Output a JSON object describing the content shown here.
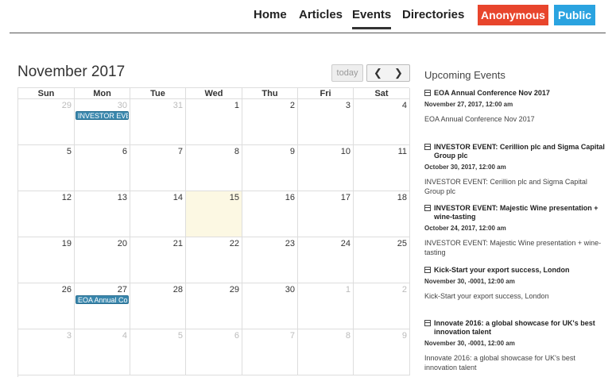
{
  "nav": {
    "links": [
      "Home",
      "Articles",
      "Events",
      "Directories"
    ],
    "anonymous": "Anonymous",
    "public": "Public"
  },
  "calendar": {
    "title": "November 2017",
    "today_label": "today",
    "prev_glyph": "❮",
    "next_glyph": "❯",
    "weekdays": [
      "Sun",
      "Mon",
      "Tue",
      "Wed",
      "Thu",
      "Fri",
      "Sat"
    ],
    "weeks": [
      [
        "29",
        "30",
        "31",
        "1",
        "2",
        "3",
        "4"
      ],
      [
        "5",
        "6",
        "7",
        "8",
        "9",
        "10",
        "11"
      ],
      [
        "12",
        "13",
        "14",
        "15",
        "16",
        "17",
        "18"
      ],
      [
        "19",
        "20",
        "21",
        "22",
        "23",
        "24",
        "25"
      ],
      [
        "26",
        "27",
        "28",
        "29",
        "30",
        "1",
        "2"
      ],
      [
        "3",
        "4",
        "5",
        "6",
        "7",
        "8",
        "9"
      ]
    ],
    "events": [
      "INVESTOR EVENT",
      "EOA Annual Conf"
    ]
  },
  "sidebar": {
    "title": "Upcoming Events",
    "events": [
      {
        "title": "EOA Annual Conference Nov 2017",
        "date": "November 27, 2017, 12:00 am",
        "desc": "EOA Annual Conference Nov 2017"
      },
      {
        "title": "INVESTOR EVENT: Cerillion plc and Sigma Capital Group plc",
        "date": "October 30, 2017, 12:00 am",
        "desc": "INVESTOR EVENT: Cerillion plc and Sigma Capital Group plc"
      },
      {
        "title": "INVESTOR EVENT: Majestic Wine presentation + wine-tasting",
        "date": "October 24, 2017, 12:00 am",
        "desc": "INVESTOR EVENT: Majestic Wine presentation + wine-tasting"
      },
      {
        "title": "Kick-Start your export success, London",
        "date": "November 30, -0001, 12:00 am",
        "desc": "Kick-Start your export success, London"
      },
      {
        "title": "Innovate 2016: a global showcase for UK's best innovation talent",
        "date": "November 30, -0001, 12:00 am",
        "desc": "Innovate 2016: a global showcase for UK's best innovation talent"
      }
    ]
  }
}
